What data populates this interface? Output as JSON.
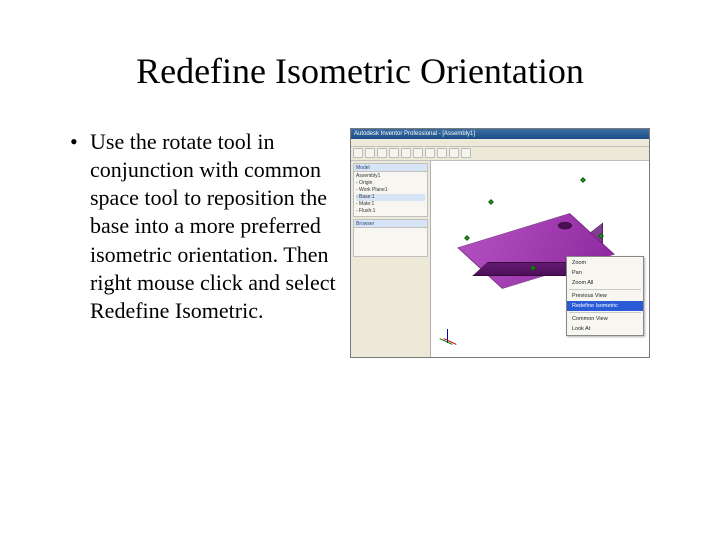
{
  "title": "Redefine Isometric Orientation",
  "bullet": {
    "mark": "•",
    "text": "Use the rotate tool in conjunction with common space tool to reposition the base into a more preferred isometric orientation. Then right mouse click and select Redefine Isometric."
  },
  "app": {
    "title": "Autodesk Inventor Professional - [Assembly1]",
    "panels": {
      "header1": "Model",
      "header2": "Browser"
    },
    "tree": [
      "Assembly1",
      "- Origin",
      "- Work Plane1",
      "- Base:1",
      "- Mate:1",
      "- Flush:1"
    ],
    "context_menu": {
      "items": [
        "Zoom",
        "Pan",
        "Zoom All",
        "",
        "Previous View",
        "Redefine Isometric",
        "",
        "Common View",
        "Look At"
      ],
      "highlighted_index": 5
    }
  }
}
